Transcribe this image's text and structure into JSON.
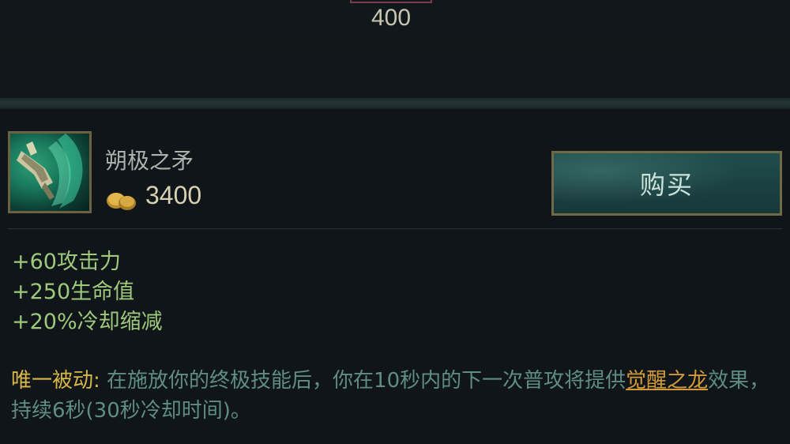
{
  "top": {
    "cost": "400"
  },
  "item": {
    "name": "朔极之矛",
    "price": "3400",
    "icon": "spear-item-icon",
    "buy_label": "购买"
  },
  "stats": [
    "+60攻击力",
    "+250生命值",
    "+20%冷却缩减"
  ],
  "passive": {
    "title": "唯一被动:",
    "text_before": "在施放你的终极技能后，你在10秒内的下一次普攻将提供",
    "link": "觉醒之龙",
    "text_after": "效果，持续6秒(30秒冷却时间)。"
  },
  "colors": {
    "stat_text": "#9ec97c",
    "passive_title": "#d8b64a",
    "passive_text": "#5f8d84",
    "link": "#d29a3a",
    "button_bg": "#1b4242",
    "button_border": "#6f6a48"
  }
}
